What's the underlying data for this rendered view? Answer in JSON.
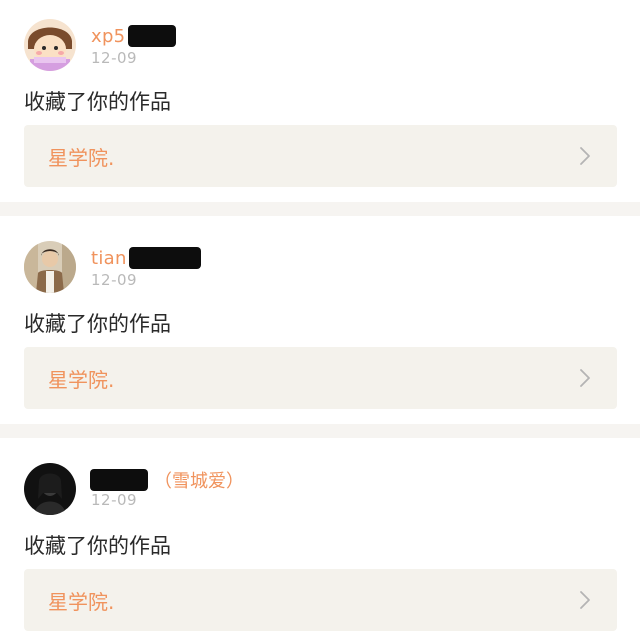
{
  "notifications": [
    {
      "username": "xp5",
      "date": "12-09",
      "action": "收藏了你的作品",
      "work_title": "星学院.",
      "avatar": "cartoon-girl-avatar",
      "remark": ""
    },
    {
      "username": "tian",
      "date": "12-09",
      "action": "收藏了你的作品",
      "work_title": "星学院.",
      "avatar": "boy-photo-avatar",
      "remark": ""
    },
    {
      "username": "",
      "date": "12-09",
      "action": "收藏了你的作品",
      "work_title": "星学院.",
      "avatar": "dark-photo-avatar",
      "remark": "（雪城爱）"
    }
  ],
  "colors": {
    "accent": "#f0935d",
    "date": "#b9b9b9",
    "text": "#2a2a2a",
    "link_bg": "#f4f2ec",
    "divider": "#f6f4f1",
    "chevron": "#b4b4b4"
  },
  "icons": {
    "link_arrow": "chevron-right-icon"
  }
}
